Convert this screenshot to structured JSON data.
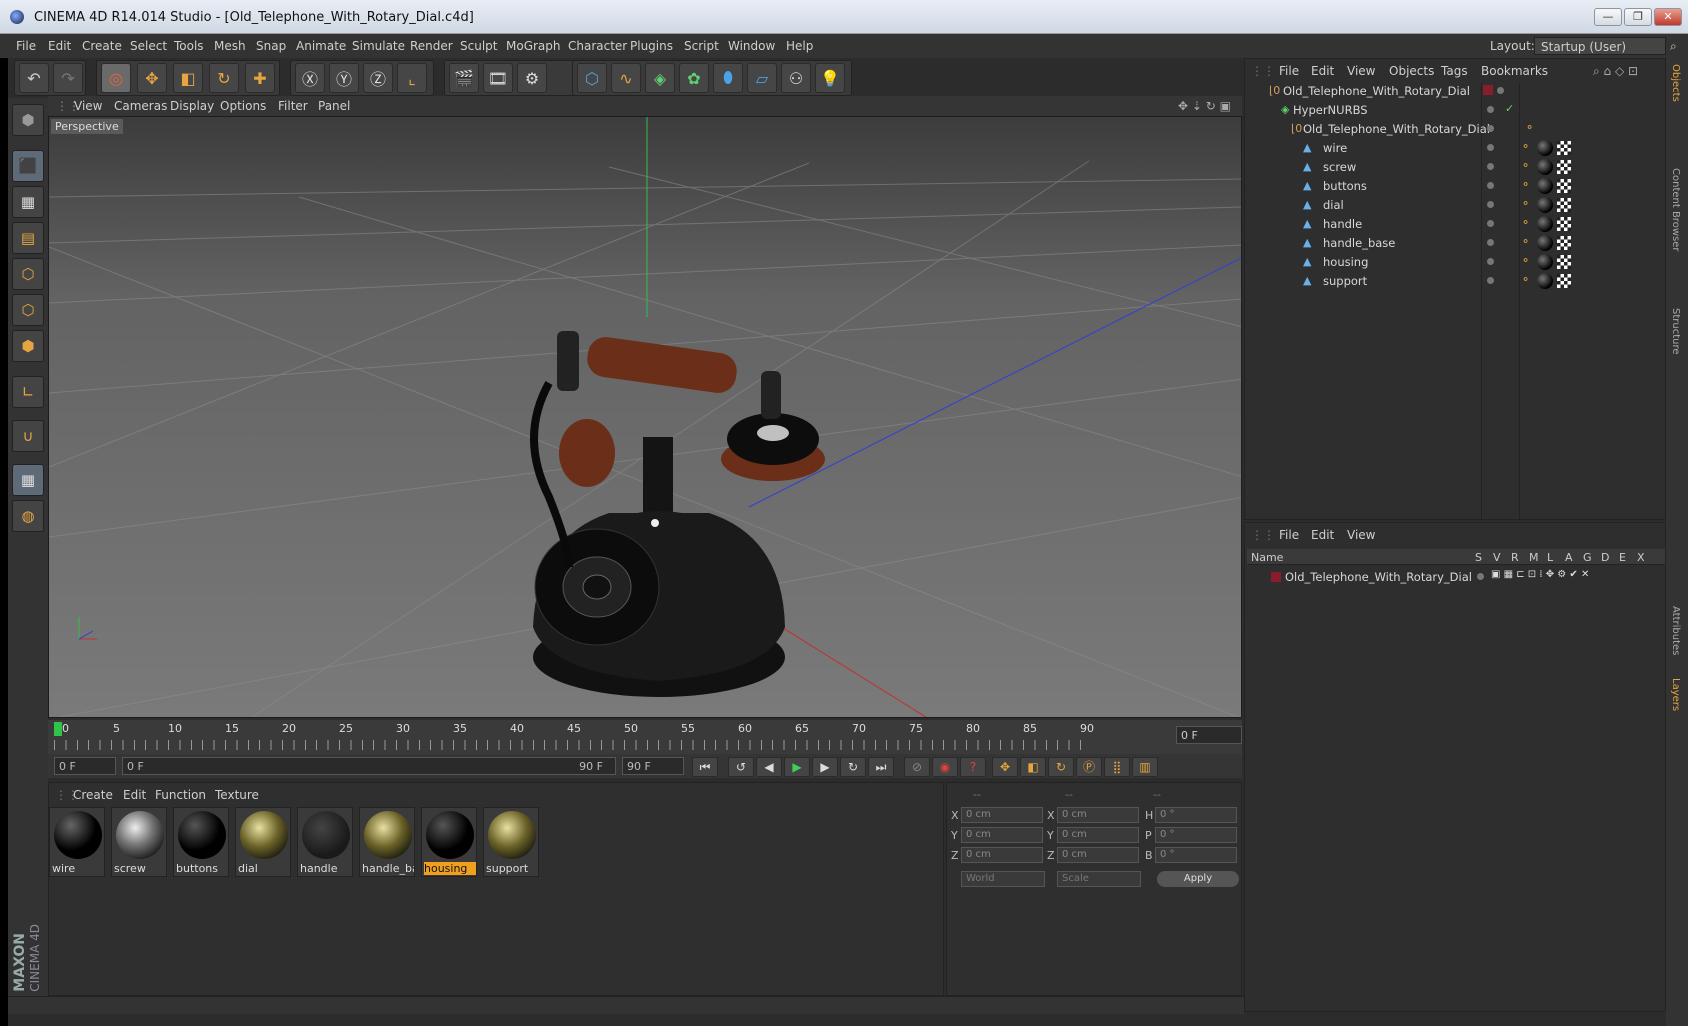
{
  "window": {
    "title": "CINEMA 4D R14.014 Studio - [Old_Telephone_With_Rotary_Dial.c4d]",
    "minimize": "—",
    "maximize": "❐",
    "close": "✕"
  },
  "menubar": {
    "items": [
      "File",
      "Edit",
      "Create",
      "Select",
      "Tools",
      "Mesh",
      "Snap",
      "Animate",
      "Simulate",
      "Render",
      "Sculpt",
      "MoGraph",
      "Character",
      "Plugins",
      "Script",
      "Window",
      "Help"
    ],
    "layout_label": "Layout:",
    "layout_value": "Startup (User)"
  },
  "viewport": {
    "menu": [
      "View",
      "Cameras",
      "Display",
      "Options",
      "Filter",
      "Panel"
    ],
    "label": "Perspective"
  },
  "timeline": {
    "ticks": [
      "0",
      "5",
      "10",
      "15",
      "20",
      "25",
      "30",
      "35",
      "40",
      "45",
      "50",
      "55",
      "60",
      "65",
      "70",
      "75",
      "80",
      "85",
      "90"
    ],
    "current_frame": "0 F",
    "start_field": "0 F",
    "range_start": "0 F",
    "range_end": "90 F",
    "end_field": "90 F"
  },
  "materials": {
    "menu": [
      "Create",
      "Edit",
      "Function",
      "Texture"
    ],
    "items": [
      {
        "name": "wire",
        "style": "black"
      },
      {
        "name": "screw",
        "style": "chrome"
      },
      {
        "name": "buttons",
        "style": "buttons"
      },
      {
        "name": "dial",
        "style": "gold"
      },
      {
        "name": "handle",
        "style": "darkgray"
      },
      {
        "name": "handle_ba:",
        "style": "gold"
      },
      {
        "name": "housing",
        "style": "black"
      },
      {
        "name": "support",
        "style": "gold"
      }
    ],
    "selected": "housing"
  },
  "coords": {
    "header": [
      "--",
      "--",
      "--"
    ],
    "rows": [
      {
        "l1": "X",
        "v1": "0 cm",
        "l2": "X",
        "v2": "0 cm",
        "l3": "H",
        "v3": "0 °"
      },
      {
        "l1": "Y",
        "v1": "0 cm",
        "l2": "Y",
        "v2": "0 cm",
        "l3": "P",
        "v3": "0 °"
      },
      {
        "l1": "Z",
        "v1": "0 cm",
        "l2": "Z",
        "v2": "0 cm",
        "l3": "B",
        "v3": "0 °"
      }
    ],
    "space": "World",
    "mode": "Scale",
    "apply": "Apply"
  },
  "objects": {
    "menu": [
      "File",
      "Edit",
      "View",
      "Objects",
      "Tags",
      "Bookmarks"
    ],
    "tree": [
      {
        "name": "Old_Telephone_With_Rotary_Dial",
        "level": 0,
        "icon": "null-object-icon"
      },
      {
        "name": "HyperNURBS",
        "level": 1,
        "icon": "hypernurbs-icon"
      },
      {
        "name": "Old_Telephone_With_Rotary_Dial",
        "level": 2,
        "icon": "null-object-icon"
      },
      {
        "name": "wire",
        "level": 3,
        "icon": "polygon-object-icon"
      },
      {
        "name": "screw",
        "level": 3,
        "icon": "polygon-object-icon"
      },
      {
        "name": "buttons",
        "level": 3,
        "icon": "polygon-object-icon"
      },
      {
        "name": "dial",
        "level": 3,
        "icon": "polygon-object-icon"
      },
      {
        "name": "handle",
        "level": 3,
        "icon": "polygon-object-icon"
      },
      {
        "name": "handle_base",
        "level": 3,
        "icon": "polygon-object-icon"
      },
      {
        "name": "housing",
        "level": 3,
        "icon": "polygon-object-icon"
      },
      {
        "name": "support",
        "level": 3,
        "icon": "polygon-object-icon"
      }
    ]
  },
  "layers": {
    "menu": [
      "File",
      "Edit",
      "View"
    ],
    "columns": [
      "Name",
      "S",
      "V",
      "R",
      "M",
      "L",
      "A",
      "G",
      "D",
      "E",
      "X"
    ],
    "rows": [
      {
        "name": "Old_Telephone_With_Rotary_Dial",
        "color": "#8a1c2c"
      }
    ]
  },
  "side_tabs": [
    "Objects",
    "Content Browser",
    "Structure",
    "Attributes",
    "Layers"
  ],
  "brand": {
    "line1": "MAXON",
    "line2": "CINEMA 4D"
  },
  "colors": {
    "accent": "#f0a020",
    "selection": "#5e6a78",
    "grid": "#8a8a8a"
  }
}
